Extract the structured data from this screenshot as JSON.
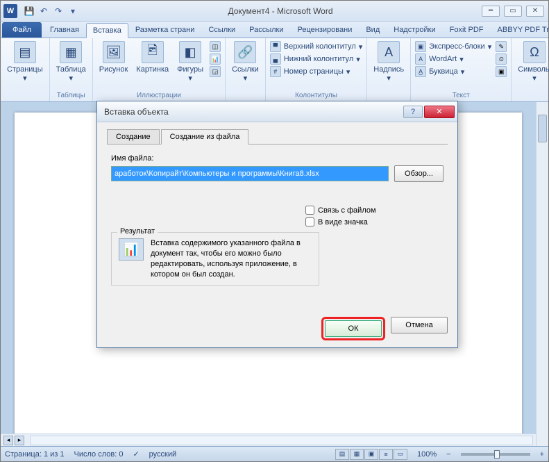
{
  "titlebar": {
    "title": "Документ4 - Microsoft Word",
    "app_letter": "W"
  },
  "ribbon_tabs": {
    "file": "Файл",
    "tabs": [
      "Главная",
      "Вставка",
      "Разметка страни",
      "Ссылки",
      "Рассылки",
      "Рецензировани",
      "Вид",
      "Надстройки",
      "Foxit PDF",
      "ABBYY PDF Trans"
    ],
    "active_index": 1
  },
  "ribbon": {
    "pages": {
      "btn": "Страницы"
    },
    "tables": {
      "btn": "Таблица",
      "group": "Таблицы"
    },
    "illustrations": {
      "picture": "Рисунок",
      "clipart": "Картинка",
      "shapes": "Фигуры",
      "chart": "",
      "group": "Иллюстрации"
    },
    "links": {
      "btn": "Ссылки"
    },
    "headerfooter": {
      "header": "Верхний колонтитул",
      "footer": "Нижний колонтитул",
      "pagenum": "Номер страницы",
      "group": "Колонтитулы"
    },
    "textbox": {
      "btn": "Надпись"
    },
    "text": {
      "quickparts": "Экспресс-блоки",
      "wordart": "WordArt",
      "dropcap": "Буквица",
      "group": "Текст"
    },
    "symbols": {
      "btn": "Символы"
    }
  },
  "dialog": {
    "title": "Вставка объекта",
    "tabs": {
      "create": "Создание",
      "fromfile": "Создание из файла"
    },
    "filename_label": "Имя файла:",
    "filename_value": "аработок\\Копирайт\\Компьютеры и программы\\Книга8.xlsx",
    "browse": "Обзор...",
    "link_check": "Связь с файлом",
    "icon_check": "В виде значка",
    "result_label": "Результат",
    "result_text": "Вставка содержимого указанного файла в документ так, чтобы его можно было редактировать, используя приложение, в котором он был создан.",
    "ok": "ОК",
    "cancel": "Отмена"
  },
  "statusbar": {
    "page": "Страница: 1 из 1",
    "words": "Число слов: 0",
    "lang": "русский",
    "zoom": "100%"
  }
}
